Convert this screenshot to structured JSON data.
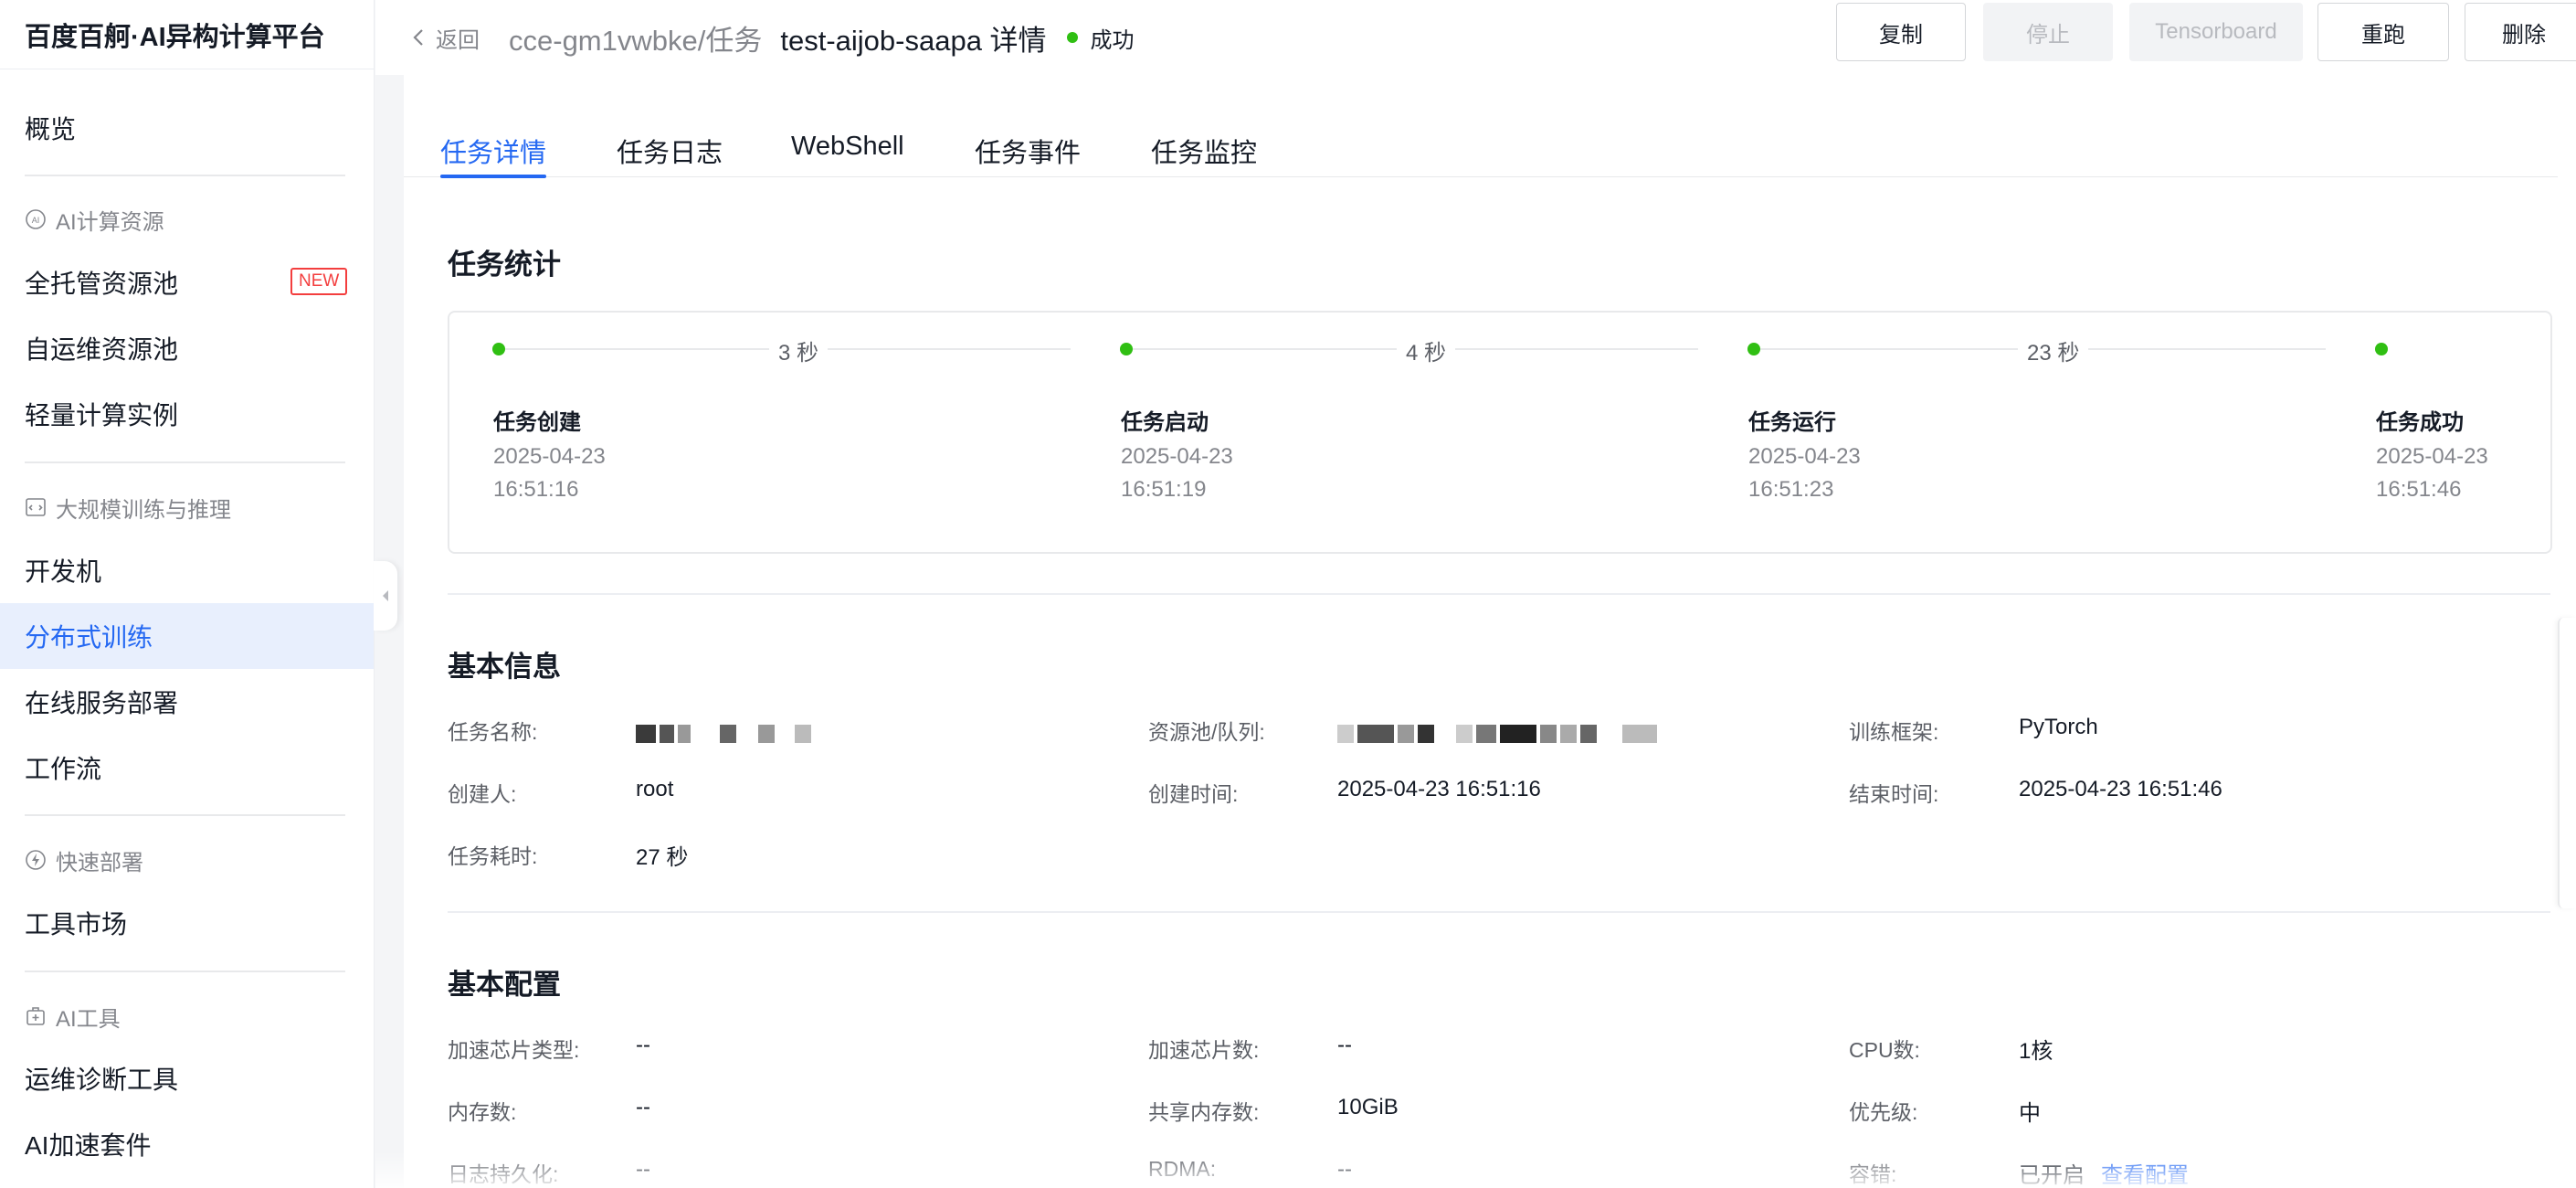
{
  "brand": "百度百舸·AI异构计算平台",
  "sidebar": {
    "overview": "概览",
    "group_compute": "AI计算资源",
    "managed_pool": "全托管资源池",
    "new_badge": "NEW",
    "self_pool": "自运维资源池",
    "light_instance": "轻量计算实例",
    "group_training": "大规模训练与推理",
    "dev_machine": "开发机",
    "distributed_training": "分布式训练",
    "online_service": "在线服务部署",
    "workflow": "工作流",
    "group_quick": "快速部署",
    "tool_market": "工具市场",
    "group_tools": "AI工具",
    "ops_tool": "运维诊断工具",
    "ai_accel": "AI加速套件"
  },
  "header": {
    "back": "返回",
    "breadcrumb": "cce-gm1vwbke/任务",
    "title": "test-aijob-saapa 详情",
    "status": "成功",
    "status_color": "#30bf13",
    "buttons": {
      "copy": "复制",
      "stop": "停止",
      "tensorboard": "Tensorboard",
      "rerun": "重跑",
      "delete": "删除"
    }
  },
  "tabs": [
    "任务详情",
    "任务日志",
    "WebShell",
    "任务事件",
    "任务监控"
  ],
  "stats": {
    "title": "任务统计",
    "steps": [
      {
        "label": "任务创建",
        "date": "2025-04-23",
        "time": "16:51:16"
      },
      {
        "label": "任务启动",
        "date": "2025-04-23",
        "time": "16:51:19"
      },
      {
        "label": "任务运行",
        "date": "2025-04-23",
        "time": "16:51:23"
      },
      {
        "label": "任务成功",
        "date": "2025-04-23",
        "time": "16:51:46"
      }
    ],
    "durations": [
      "3 秒",
      "4 秒",
      "23 秒"
    ]
  },
  "basic_info": {
    "title": "基本信息",
    "task_name_label": "任务名称:",
    "pool_label": "资源池/队列:",
    "framework_label": "训练框架:",
    "framework": "PyTorch",
    "creator_label": "创建人:",
    "creator": "root",
    "created_label": "创建时间:",
    "created": "2025-04-23 16:51:16",
    "ended_label": "结束时间:",
    "ended": "2025-04-23 16:51:46",
    "duration_label": "任务耗时:",
    "duration": "27 秒"
  },
  "basic_config": {
    "title": "基本配置",
    "chip_type_label": "加速芯片类型:",
    "chip_type": "--",
    "chip_count_label": "加速芯片数:",
    "chip_count": "--",
    "cpu_label": "CPU数:",
    "cpu": "1核",
    "memory_label": "内存数:",
    "memory": "--",
    "shm_label": "共享内存数:",
    "shm": "10GiB",
    "priority_label": "优先级:",
    "priority": "中",
    "log_persist_label": "日志持久化:",
    "log_persist": "--",
    "rdma_label": "RDMA:",
    "rdma": "--",
    "fault_label": "容错:",
    "fault": "已开启",
    "view_config": "查看配置"
  }
}
